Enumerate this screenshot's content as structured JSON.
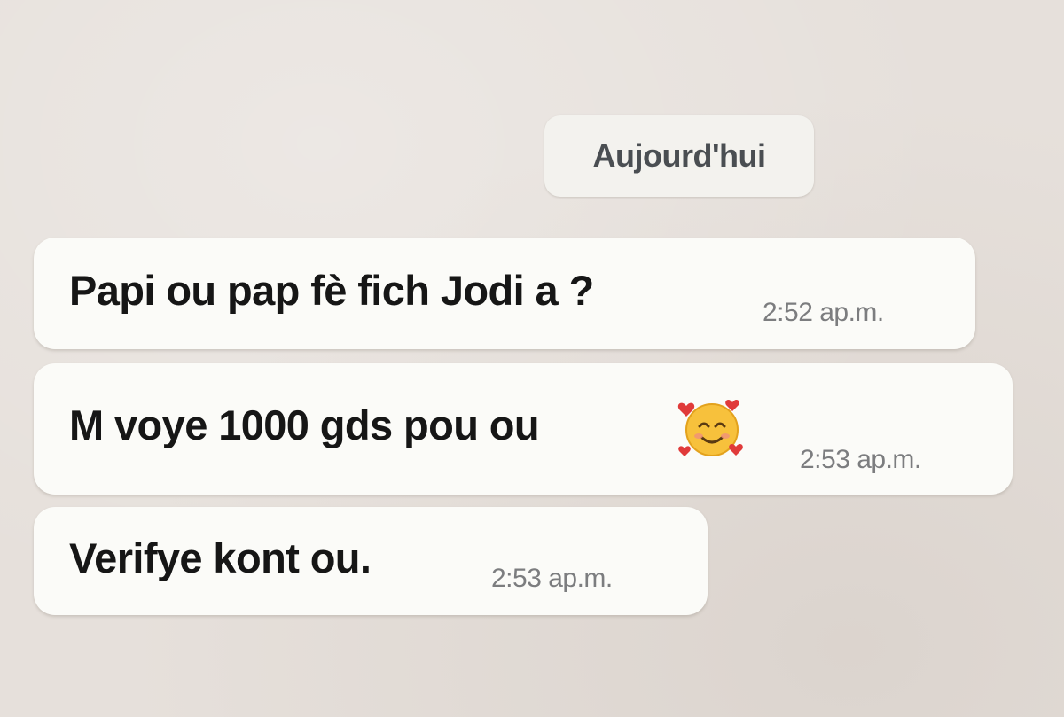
{
  "chat": {
    "date_divider": "Aujourd'hui",
    "messages": [
      {
        "text": "Papi ou pap fè fich Jodi a ?",
        "time": "2:52 ap.m."
      },
      {
        "text": "M voye 1000 gds pou ou",
        "emoji": "smiling-face-with-hearts-icon",
        "time": "2:53 ap.m."
      },
      {
        "text": "Verifye kont ou.",
        "time": "2:53 ap.m."
      }
    ]
  },
  "colors": {
    "background": "#e6e0db",
    "bubble": "#fbfbf8",
    "text": "#161616",
    "timestamp": "#7c7d7f"
  }
}
